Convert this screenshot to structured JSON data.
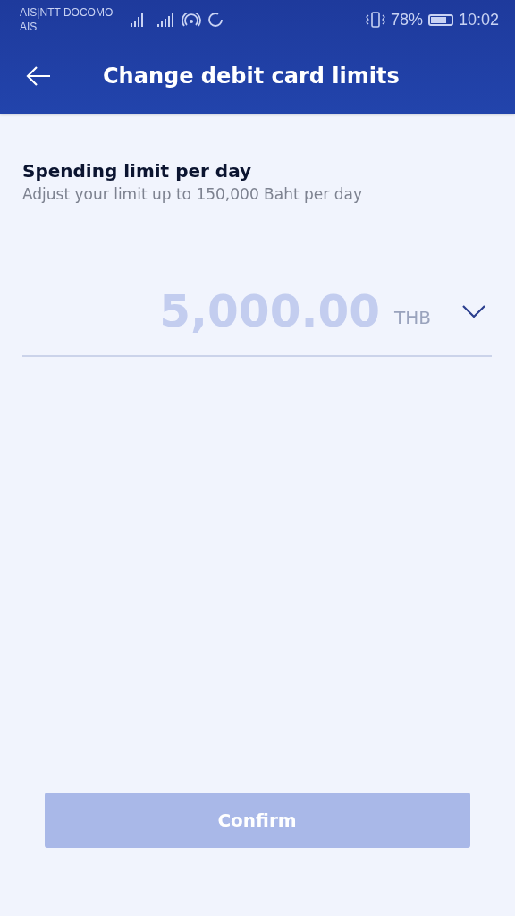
{
  "status_bar": {
    "carrier_lines": [
      "AIS|NTT DOCOMO",
      "AIS"
    ],
    "battery_percent": "78%",
    "time": "10:02"
  },
  "header": {
    "title": "Change debit card limits"
  },
  "limit": {
    "title": "Spending limit per day",
    "description": "Adjust your limit up to 150,000 Baht per day"
  },
  "amount_field": {
    "placeholder": "5,000.00",
    "currency": "THB"
  },
  "confirm_button": {
    "label": "Confirm",
    "disabled": true
  }
}
